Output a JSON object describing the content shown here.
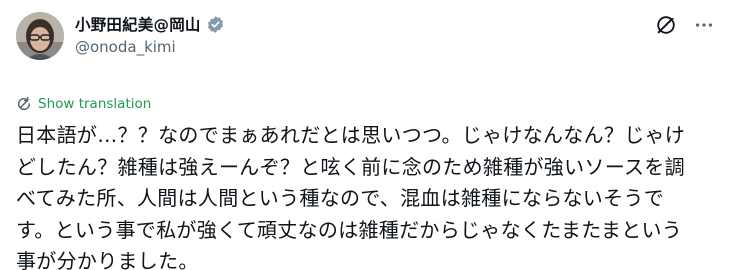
{
  "post": {
    "author": {
      "display_name": "小野田紀美@岡山",
      "handle": "@onoda_kimi",
      "verified": true,
      "verified_color": "#829aab"
    },
    "actions": {
      "grok_icon": "grok-icon",
      "more_icon": "more-icon"
    },
    "translate": {
      "label": "Show translation",
      "color": "#1d9b50"
    },
    "lines": [
      "日本語が…？？なのでまぁあれだとは思いつつ。じゃけなんなん？じゃけ",
      "どしたん？雑種は強えーんぞ？と呟く前に念のため雑種が強いソースを調",
      "べてみた所、人間は人間という種なので、混血は雑種にならないそうで",
      "す。という事で私が強くて頑丈なのは雑種だからじゃなくたまたまという",
      "事が分かりました。"
    ]
  }
}
